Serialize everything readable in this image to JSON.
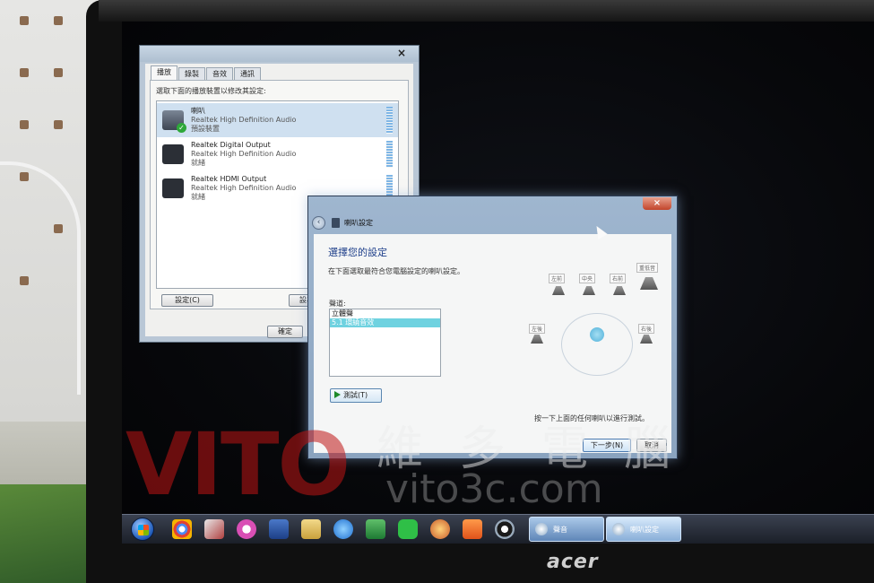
{
  "sound_dialog": {
    "close_glyph": "×",
    "tabs": [
      "播放",
      "錄製",
      "音效",
      "通訊"
    ],
    "instruction": "選取下面的播放裝置以修改其設定:",
    "devices": [
      {
        "name": "喇叭",
        "driver": "Realtek High Definition Audio",
        "status": "預設裝置",
        "selected": true,
        "default": true
      },
      {
        "name": "Realtek Digital Output",
        "driver": "Realtek High Definition Audio",
        "status": "就緒",
        "selected": false,
        "default": false
      },
      {
        "name": "Realtek HDMI Output",
        "driver": "Realtek High Definition Audio",
        "status": "就緒",
        "selected": false,
        "default": false
      }
    ],
    "configure_button": "設定(C)",
    "set_default_button": "設為",
    "ok_button": "確定"
  },
  "speaker_wizard": {
    "close_glyph": "×",
    "back_glyph": "‹",
    "title": "喇叭設定",
    "heading": "選擇您的設定",
    "description": "在下面選取最符合您電腦設定的喇叭設定。",
    "channels_label": "聲道:",
    "channels": [
      "立體聲",
      "5.1 環繞音效"
    ],
    "selected_channel": 1,
    "test_button": "測試(T)",
    "speaker_labels": [
      "左前",
      "中央",
      "右前",
      "重低音",
      "左後",
      "右後"
    ],
    "hint": "按一下上面的任何喇叭以進行測試。",
    "next_button": "下一步(N)",
    "cancel_button": "取消"
  },
  "taskbar": {
    "tasks": [
      {
        "label": "聲音",
        "active": false
      },
      {
        "label": "喇叭設定",
        "active": true
      }
    ]
  },
  "watermark": {
    "logo": "VITO",
    "chinese": "維多電腦",
    "url": "vito3c.com"
  },
  "bezel": {
    "brand": "acer"
  }
}
